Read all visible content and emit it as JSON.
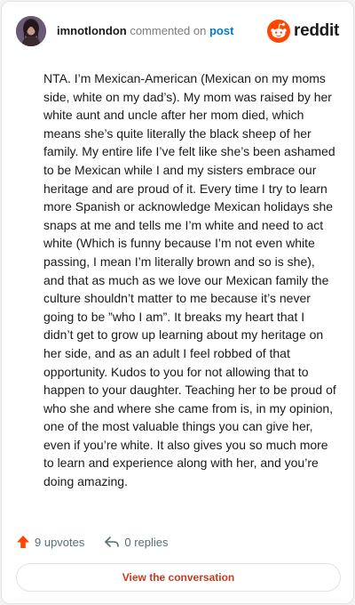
{
  "colors": {
    "accent": "#ff4500",
    "link": "#0079d3",
    "button_text": "#c93a1c",
    "muted": "#576f76"
  },
  "header": {
    "username": "imnotlondon",
    "commented_on": "commented on",
    "post_link": "post",
    "brand": "reddit"
  },
  "comment": {
    "text": "NTA. I’m Mexican-American (Mexican on my moms side, white on my dad’s). My mom was raised by her white aunt and uncle after her mom died, which means she’s quite literally the black sheep of her family. My entire life I’ve felt like she’s been ashamed to be Mexican while I and my sisters embrace our heritage and are proud of it. Every time I try to learn more Spanish or acknowledge Mexican holidays she snaps at me and tells me I’m white and need to act white (Which is funny because I’m not even white passing, I mean I’m literally brown and so is she), and that as much as we love our Mexican family the culture shouldn’t matter to me because it’s never going to be ”who I am”. It breaks my heart that I didn’t get to grow up learning about my heritage on her side, and as an adult I feel robbed of that opportunity. Kudos to you for not allowing that to happen to your daughter. Teaching her to be proud of who she and where she came from is, in my opinion, one of the most valuable things you can give her, even if you’re white. It also gives you so much more to learn and experience along with her, and you’re doing amazing."
  },
  "actions": {
    "upvotes": "9 upvotes",
    "replies": "0 replies"
  },
  "footer": {
    "view_button": "View the conversation"
  },
  "icons": {
    "avatar": "avatar",
    "brand": "reddit-snoo-icon",
    "upvote": "upvote-arrow-icon",
    "reply": "reply-arrow-icon"
  }
}
